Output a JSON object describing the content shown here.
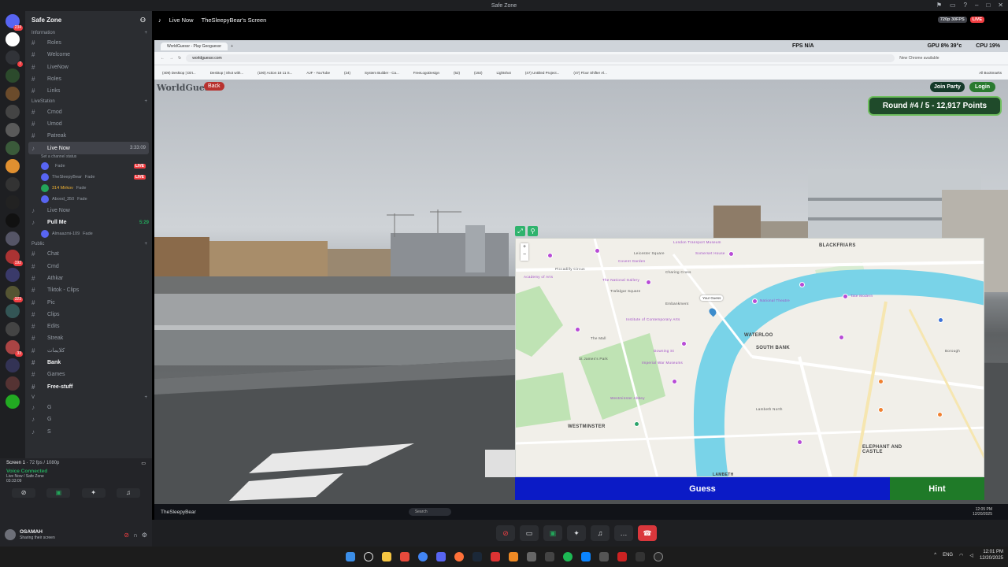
{
  "window": {
    "title": "Safe Zone"
  },
  "server": {
    "name": "Safe Zone",
    "rail_badges": [
      "234",
      "7",
      "192",
      "323",
      "33"
    ]
  },
  "categories": {
    "information": "Information",
    "livestation": "LiveStation",
    "public": "Public",
    "voice": "V"
  },
  "info_channels": [
    "Roles",
    "Welcome",
    "LiveNow",
    "Roles",
    "Links"
  ],
  "live_channels": [
    "Cmod",
    "Umod",
    "Patreak"
  ],
  "live_now": {
    "label": "Live Now",
    "time": "3:33:09",
    "status": "Set a channel status"
  },
  "live_users": [
    {
      "name": "",
      "tag": "Fade",
      "live": "LIVE"
    },
    {
      "name": "TheSleepyBear",
      "tag": "Fade",
      "live": "LIVE"
    },
    {
      "name": "314 Mirkov",
      "tag": "Fade",
      "live": ""
    },
    {
      "name": "Abood_350",
      "tag": "Fade",
      "live": ""
    }
  ],
  "live_now2": "Live Now",
  "pull_me": {
    "label": "Pull Me",
    "time": "5:29"
  },
  "pull_user": {
    "name": "Almaazmi-109",
    "tag": "Fade"
  },
  "public_channels": [
    "Chat",
    "Cmd",
    "Athkar",
    "Tiktok - Clips",
    "Pic",
    "Clips",
    "Edits",
    "Streak",
    "كلايمات",
    "Bank",
    "Games",
    "Free-stuff"
  ],
  "voice_channels": [
    "G",
    "G",
    "S"
  ],
  "screen": {
    "label": "Screen 1",
    "sub": "72 fps / 1080p"
  },
  "voice": {
    "title": "Voice Connected",
    "sub": "Live Now / Safe Zone",
    "time": "03:33:09"
  },
  "user": {
    "name": "OSAMAH",
    "status": "Sharing their screen"
  },
  "stream": {
    "live_label": "Live Now",
    "viewer": "TheSleepyBear's Screen",
    "quality": "720p 30FPS",
    "live_badge": "LIVE"
  },
  "browser": {
    "tab": "WorldGuessr - Play Geoguessr",
    "url": "worldguessr.com",
    "chrome_note": "New Chrome available",
    "all_bookmarks": "All Bookmarks",
    "bookmarks": [
      "(409) Desktop | Dirt...",
      "Desktop | Shot with...",
      "(190) Action 18 11 S...",
      "AJF - YouTube",
      "(24)",
      "System Builder - Ca...",
      "FreeLogoDesign",
      "(52)",
      "(192)",
      "Lightshot",
      "(47) Untitled Project...",
      "(47) Floor Shifter Al..."
    ]
  },
  "overlay": {
    "fps": "FPS N/A",
    "gpu": "GPU 8% 39°c",
    "cpu": "CPU 19%"
  },
  "game": {
    "logo": "WorldGuessr",
    "back": "Back",
    "join": "Join Party",
    "login": "Login",
    "round": "Round #4 / 5 - 12,917 Points",
    "guess": "Guess",
    "hint": "Hint",
    "your_guess": "Your Guess",
    "map_labels": [
      "WATERLOO",
      "SOUTH BANK",
      "WESTMINSTER",
      "BLACKFRIARS",
      "ELEPHANT AND CASTLE",
      "LAMBETH"
    ],
    "map_small_labels": [
      "London Transport Museum",
      "Somerset House",
      "Leicester Square",
      "Covent Garden",
      "Piccadilly Circus",
      "The National Gallery",
      "Trafalgar Square",
      "Charing Cross",
      "Embankment",
      "Institute of Contemporary Arts",
      "Academy of Arts",
      "St James's Park",
      "The Mall",
      "Downing St",
      "Imperial War Museums",
      "Westminster Abbey",
      "National Theatre",
      "Tate Modern",
      "Lambeth North",
      "Borough"
    ]
  },
  "streamer_taskbar": {
    "name": "TheSleepyBear",
    "search": "Search",
    "time": "12:05 PM",
    "date": "12/20/2025"
  },
  "host_taskbar": {
    "lang": "ENG",
    "time": "12:01 PM",
    "date": "12/20/2025"
  }
}
